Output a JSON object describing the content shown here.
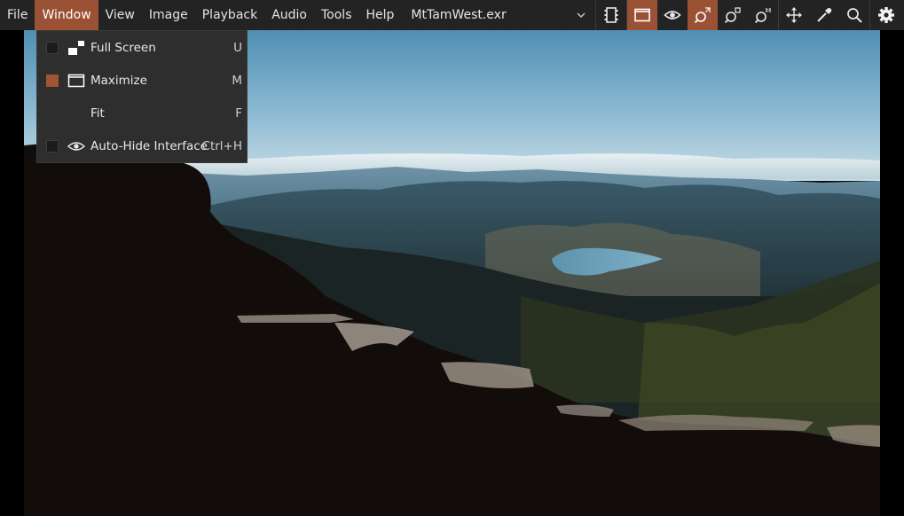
{
  "menubar": {
    "items": [
      {
        "label": "File"
      },
      {
        "label": "Window",
        "active": true
      },
      {
        "label": "View"
      },
      {
        "label": "Image"
      },
      {
        "label": "Playback"
      },
      {
        "label": "Audio"
      },
      {
        "label": "Tools"
      },
      {
        "label": "Help"
      }
    ],
    "file_selector": {
      "value": "MtTamWest.exr",
      "icon": "chevron-down-icon"
    }
  },
  "toolbar": {
    "buttons": [
      {
        "icon": "film-strip-icon",
        "on": false
      },
      {
        "icon": "maximize-window-icon",
        "on": true
      },
      {
        "icon": "eye-icon",
        "on": false
      },
      {
        "icon": "zoom-fit-icon",
        "on": true
      },
      {
        "icon": "zoom-region-icon",
        "on": false
      },
      {
        "icon": "zoom-one-to-one-icon",
        "on": false
      },
      {
        "icon": "move-arrows-icon",
        "on": false
      },
      {
        "icon": "eyedropper-icon",
        "on": false
      },
      {
        "icon": "search-icon",
        "on": false
      },
      {
        "icon": "gear-icon",
        "on": false
      }
    ],
    "accent_color": "#9a5134"
  },
  "window_menu": {
    "items": [
      {
        "label": "Full Screen",
        "shortcut": "U",
        "checkbox": true,
        "checked": false,
        "icon": "full-screen-icon"
      },
      {
        "label": "Maximize",
        "shortcut": "M",
        "checkbox": true,
        "checked": true,
        "icon": "maximize-icon"
      },
      {
        "label": "Fit",
        "shortcut": "F",
        "checkbox": false,
        "checked": false,
        "icon": ""
      },
      {
        "label": "Auto-Hide Interface",
        "shortcut": "Ctrl+H",
        "checkbox": true,
        "checked": false,
        "icon": "eye-icon"
      }
    ]
  },
  "viewer": {
    "image": "mountain-landscape-photo",
    "content": "Mount Tamalpais west view: sky, fog band, hills, lake, dark rocky foreground"
  }
}
